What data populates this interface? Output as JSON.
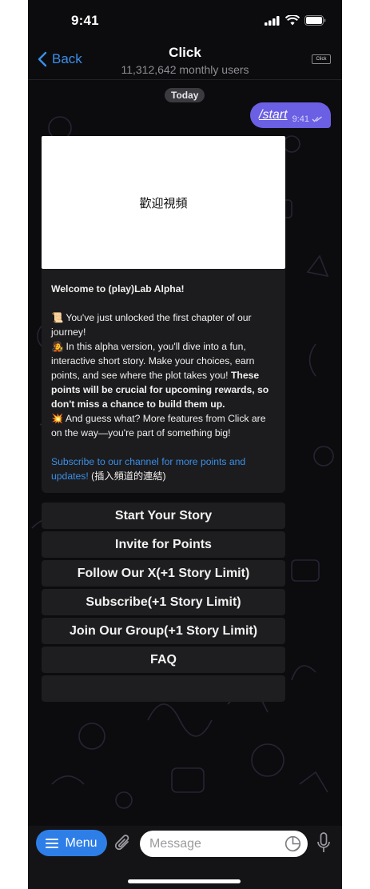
{
  "status": {
    "time": "9:41"
  },
  "nav": {
    "back_label": "Back",
    "title": "Click",
    "subtitle": "11,312,642 monthly users",
    "avatar_text": "Click"
  },
  "chat": {
    "date": "Today",
    "outgoing": {
      "text": "/start",
      "time": "9:41"
    },
    "incoming": {
      "video_label": "歡迎視頻",
      "heading": "Welcome to (play)Lab Alpha!",
      "para1": "📜 You've just unlocked the first chapter of our journey!",
      "para2_normal": "🧑‍🎤 In this alpha version, you'll dive into a fun, interactive short story. Make your choices, earn points, and see where the plot takes you! ",
      "para2_bold": "These points will be crucial for upcoming rewards, so don't miss a chance to build them up.",
      "para3": "💥 And guess what? More features from Click are on the way—you're part of something big!",
      "link_text": "Subscribe to our channel for more points and updates!",
      "link_suffix": " (插入頻道的連結)"
    }
  },
  "keyboard": {
    "buttons": [
      "Start Your Story",
      "Invite for Points",
      "Follow Our X(+1 Story Limit)",
      "Subscribe(+1 Story Limit)",
      "Join Our Group(+1 Story Limit)",
      "FAQ",
      ""
    ]
  },
  "input": {
    "menu_label": "Menu",
    "placeholder": "Message"
  },
  "colors": {
    "accent": "#2e7ee8",
    "outgoing_bubble": "#6b5fe3",
    "link": "#3b8fe8",
    "background": "#0c0c0f"
  }
}
